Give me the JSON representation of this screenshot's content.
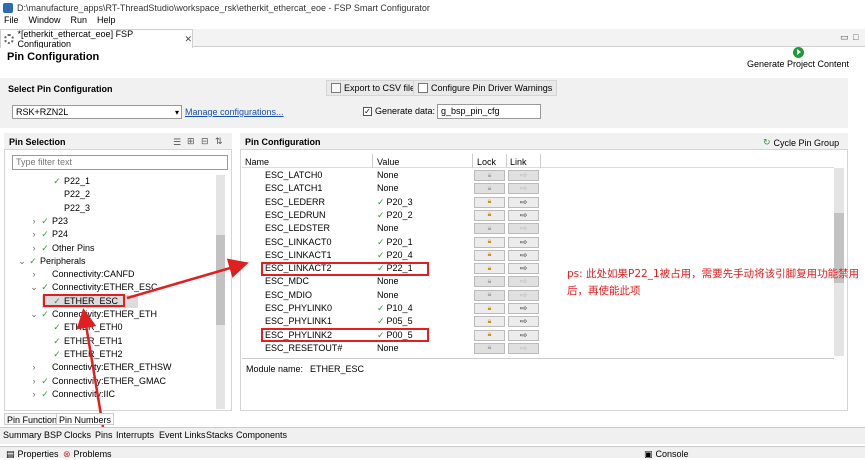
{
  "window": {
    "title": "D:\\manufacture_apps\\RT-ThreadStudio\\workspace_rsk\\etherkit_ethercat_eoe - FSP Smart Configurator"
  },
  "menu": [
    "File",
    "Window",
    "Run",
    "Help"
  ],
  "editor_tab": {
    "label": "*[etherkit_ethercat_eoe] FSP Configuration"
  },
  "page": {
    "title": "Pin Configuration",
    "generate_label": "Generate Project Content"
  },
  "select_pin_config": {
    "title": "Select Pin Configuration",
    "export_label": "Export to CSV file",
    "warnings_label": "Configure Pin Driver Warnings",
    "board_value": "RSK+RZN2L",
    "manage_link": "Manage configurations...",
    "generate_data_label": "Generate data:",
    "generate_data_value": "g_bsp_pin_cfg",
    "generate_data_checked": true
  },
  "pin_selection": {
    "title": "Pin Selection",
    "filter_placeholder": "Type filter text",
    "tree": [
      {
        "label": "P22_1",
        "level": 3,
        "checked": true,
        "chevron": ""
      },
      {
        "label": "P22_2",
        "level": 3,
        "checked": false,
        "chevron": ""
      },
      {
        "label": "P22_3",
        "level": 3,
        "checked": false,
        "chevron": ""
      },
      {
        "label": "P23",
        "level": 2,
        "checked": true,
        "chevron": ">"
      },
      {
        "label": "P24",
        "level": 2,
        "checked": true,
        "chevron": ">"
      },
      {
        "label": "Other Pins",
        "level": 2,
        "checked": true,
        "chevron": ">"
      },
      {
        "label": "Peripherals",
        "level": 1,
        "checked": true,
        "chevron": "v"
      },
      {
        "label": "Connectivity:CANFD",
        "level": 2,
        "checked": false,
        "chevron": ">"
      },
      {
        "label": "Connectivity:ETHER_ESC",
        "level": 2,
        "checked": true,
        "chevron": "v"
      },
      {
        "label": "ETHER_ESC",
        "level": 3,
        "checked": true,
        "chevron": "",
        "selected": true
      },
      {
        "label": "Connectivity:ETHER_ETH",
        "level": 2,
        "checked": true,
        "chevron": "v"
      },
      {
        "label": "ETHER_ETH0",
        "level": 3,
        "checked": true,
        "chevron": ""
      },
      {
        "label": "ETHER_ETH1",
        "level": 3,
        "checked": true,
        "chevron": ""
      },
      {
        "label": "ETHER_ETH2",
        "level": 3,
        "checked": true,
        "chevron": ""
      },
      {
        "label": "Connectivity:ETHER_ETHSW",
        "level": 2,
        "checked": false,
        "chevron": ">"
      },
      {
        "label": "Connectivity:ETHER_GMAC",
        "level": 2,
        "checked": true,
        "chevron": ">"
      },
      {
        "label": "Connectivity:IIC",
        "level": 2,
        "checked": true,
        "chevron": ">"
      }
    ]
  },
  "pin_configuration": {
    "title": "Pin Configuration",
    "cycle_label": "Cycle Pin Group",
    "columns": [
      "Name",
      "Value",
      "Lock",
      "Link"
    ],
    "rows": [
      {
        "name": "ESC_LATCH0",
        "value": "None",
        "ok": false
      },
      {
        "name": "ESC_LATCH1",
        "value": "None",
        "ok": false
      },
      {
        "name": "ESC_LEDERR",
        "value": "P20_3",
        "ok": true
      },
      {
        "name": "ESC_LEDRUN",
        "value": "P20_2",
        "ok": true
      },
      {
        "name": "ESC_LEDSTER",
        "value": "None",
        "ok": false
      },
      {
        "name": "ESC_LINKACT0",
        "value": "P20_1",
        "ok": true
      },
      {
        "name": "ESC_LINKACT1",
        "value": "P20_4",
        "ok": true
      },
      {
        "name": "ESC_LINKACT2",
        "value": "P22_1",
        "ok": true
      },
      {
        "name": "ESC_MDC",
        "value": "None",
        "ok": false
      },
      {
        "name": "ESC_MDIO",
        "value": "None",
        "ok": false
      },
      {
        "name": "ESC_PHYLINK0",
        "value": "P10_4",
        "ok": true
      },
      {
        "name": "ESC_PHYLINK1",
        "value": "P05_5",
        "ok": true
      },
      {
        "name": "ESC_PHYLINK2",
        "value": "P00_5",
        "ok": true
      },
      {
        "name": "ESC_RESETOUT#",
        "value": "None",
        "ok": false
      }
    ],
    "module_label": "Module name:",
    "module_value": "ETHER_ESC"
  },
  "annotation": "ps: 此处如果P22_1被占用，需要先手动将该引脚复用功能禁用后，再使能此项",
  "lower_tabs": [
    "Pin Function",
    "Pin Numbers"
  ],
  "bottom_tabs": [
    "Summary",
    "BSP",
    "Clocks",
    "Pins",
    "Interrupts",
    "Event Links",
    "Stacks",
    "Components"
  ],
  "status_views": [
    "Properties",
    "Problems",
    "Console"
  ],
  "colors": {
    "accent_red": "#e02020",
    "check_green": "#2e9a34"
  }
}
